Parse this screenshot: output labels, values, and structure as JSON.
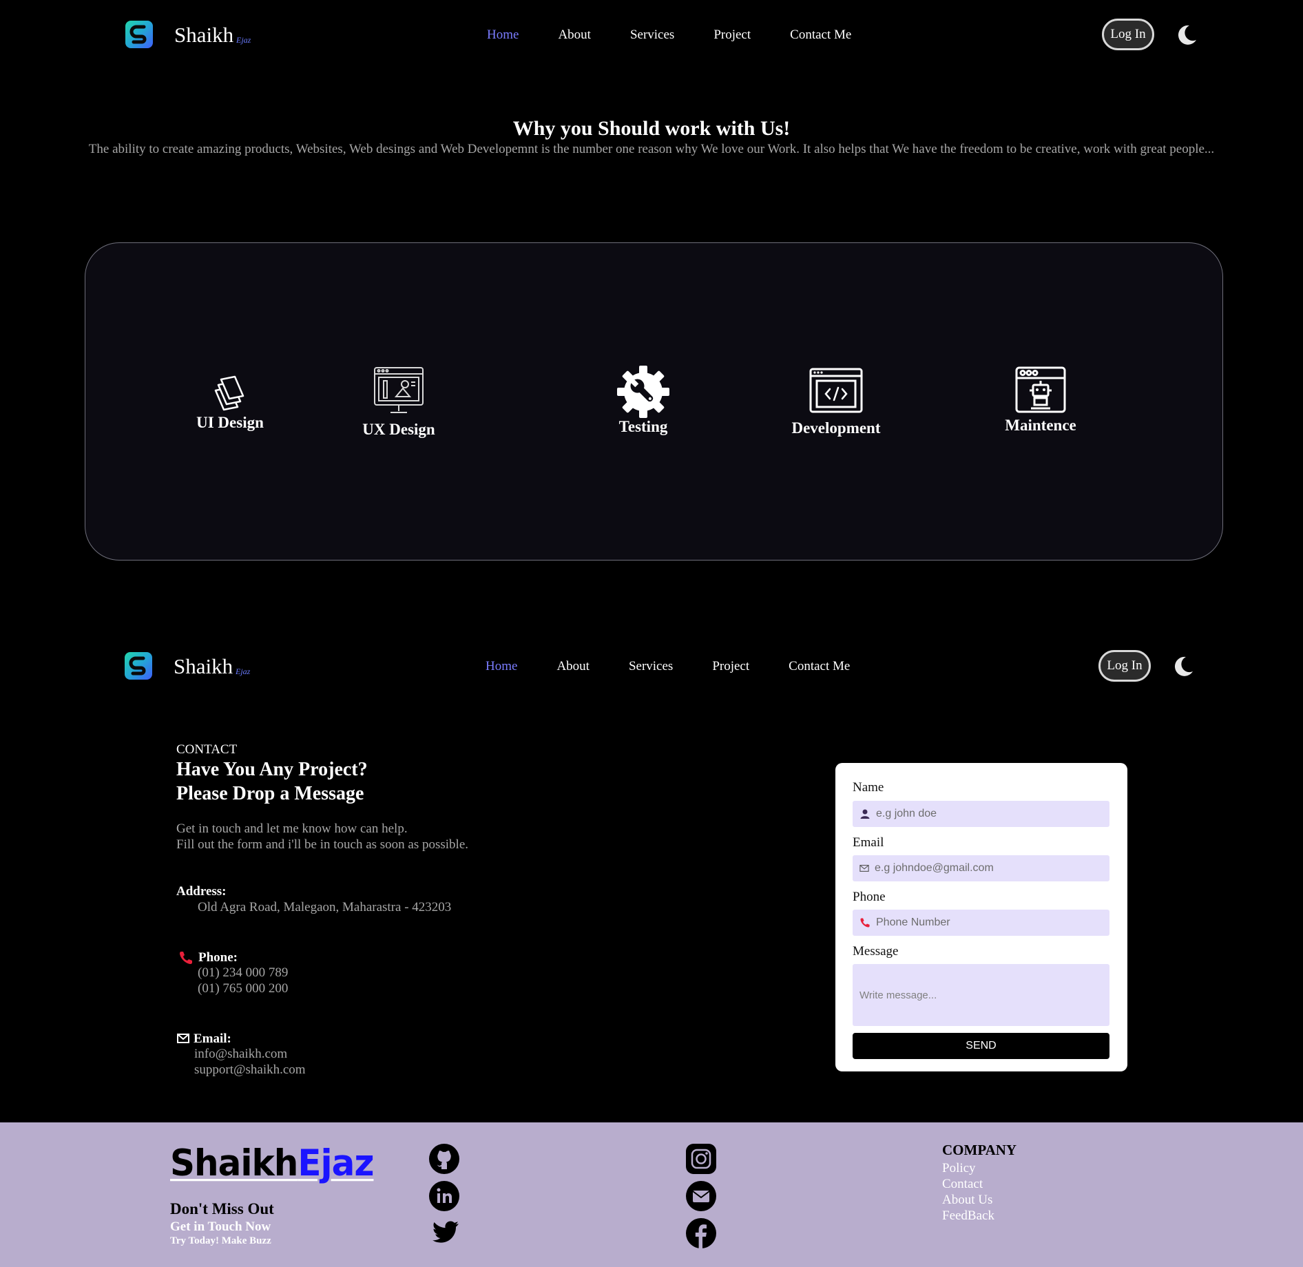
{
  "nav": {
    "brand": "Shaikh",
    "brand_sub": "Ejaz",
    "links": [
      "Home",
      "About",
      "Services",
      "Project",
      "Contact Me"
    ],
    "active": "Home",
    "login": "Log In",
    "theme_icon": "moon-icon"
  },
  "why": {
    "title": "Why you Should work with Us!",
    "text": "The ability to create amazing products, Websites, Web desings and Web Developemnt is the number one reason why We love our Work. It also helps that We have the freedom to be creative, work with great people...",
    "services": [
      {
        "label": "UI Design",
        "icon": "layers-icon"
      },
      {
        "label": "UX Design",
        "icon": "design-monitor-icon"
      },
      {
        "label": "Testing",
        "icon": "wrench-gear-icon"
      },
      {
        "label": "Development",
        "icon": "code-window-icon"
      },
      {
        "label": "Maintence",
        "icon": "robot-window-icon"
      }
    ]
  },
  "contact": {
    "kicker": "CONTACT",
    "title_line1": "Have You Any Project?",
    "title_line2": "Please Drop a Message",
    "desc_line1": "Get in touch and let me know how can help.",
    "desc_line2": "Fill out the form and i'll be in touch as soon as possible.",
    "address_label": "Address:",
    "address": "Old Agra Road, Malegaon, Maharastra - 423203",
    "phone_label": "Phone:",
    "phones": [
      "(01) 234 000 789",
      "(01) 765 000 200"
    ],
    "email_label": "Email:",
    "emails": [
      "info@shaikh.com",
      "support@shaikh.com"
    ]
  },
  "form": {
    "name_label": "Name",
    "name_placeholder": "e.g john doe",
    "email_label": "Email",
    "email_placeholder": "e.g johndoe@gmail.com",
    "phone_label": "Phone",
    "phone_placeholder": "Phone Number",
    "message_label": "Message",
    "message_placeholder": "Write message...",
    "send": "SEND"
  },
  "footer": {
    "brand_part1": "Shaikh",
    "brand_part2": "Ejaz",
    "dont_miss": "Don't Miss Out",
    "get_in_touch": "Get in Touch Now",
    "try_today": "Try Today! Make Buzz",
    "social_icons": [
      "github-icon",
      "linkedin-icon",
      "twitter-icon",
      "instagram-icon",
      "mail-icon",
      "facebook-icon"
    ],
    "company_heading": "COMPANY",
    "company_links": [
      "Policy",
      "Contact",
      "About Us",
      "FeedBack"
    ]
  },
  "colors": {
    "background": "#000000",
    "accent_link": "#7a7cff",
    "card_bg": "#0c0b12",
    "input_bg": "#e5e0fb",
    "footer_bg": "#b8adcd",
    "brand_blue": "#1b14ff",
    "phone_red": "#e8203a"
  }
}
